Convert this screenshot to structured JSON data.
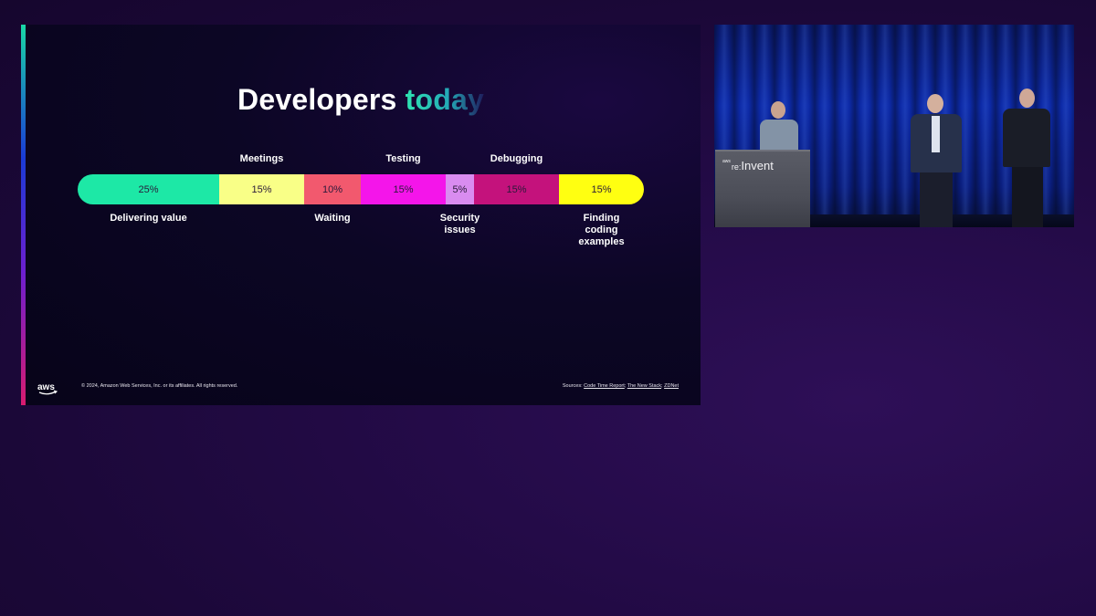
{
  "slide": {
    "title_main": "Developers",
    "title_accent": "today",
    "copyright": "© 2024, Amazon Web Services, Inc. or its affiliates. All rights reserved.",
    "sources_label": "Sources:",
    "sources": [
      "Code Time Report",
      "The New Stack",
      "ZDNet"
    ],
    "logo_text": "aws"
  },
  "chart_data": {
    "type": "bar",
    "title": "Developers today",
    "categories": [
      "Delivering value",
      "Meetings",
      "Waiting",
      "Testing",
      "Security issues",
      "Debugging",
      "Finding coding examples"
    ],
    "values": [
      25,
      15,
      10,
      15,
      5,
      15,
      15
    ],
    "value_labels": [
      "25%",
      "15%",
      "10%",
      "15%",
      "5%",
      "15%",
      "15%"
    ],
    "unit": "%",
    "colors": [
      "#1de8a6",
      "#f9ff87",
      "#f2596e",
      "#f415ea",
      "#d98cf0",
      "#c4127c",
      "#ffff11"
    ],
    "label_position": [
      "below",
      "above",
      "below",
      "above",
      "below",
      "above",
      "below"
    ],
    "orientation": "horizontal-stacked"
  },
  "video": {
    "podium_brand_small": "aws",
    "podium_brand_re": "re:",
    "podium_brand_name": "Invent"
  }
}
